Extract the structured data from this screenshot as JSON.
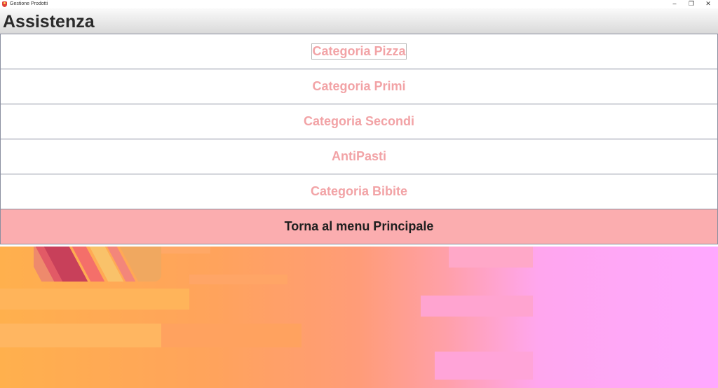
{
  "window": {
    "title": "Gestione Prodotti",
    "minimize": "–",
    "maximize": "❐",
    "close": "✕"
  },
  "header": {
    "title": "Assistenza"
  },
  "menu": {
    "items": [
      {
        "label": "Categoria Pizza"
      },
      {
        "label": "Categoria Primi"
      },
      {
        "label": "Categoria Secondi"
      },
      {
        "label": "AntiPasti"
      },
      {
        "label": "Categoria Bibite"
      }
    ],
    "back_label": "Torna al menu Principale"
  },
  "colors": {
    "menu_text": "#f2a3a6",
    "back_button_bg": "#fbadaf",
    "backdrop_left": "#ffb04d",
    "backdrop_right": "#ffa8ff"
  }
}
